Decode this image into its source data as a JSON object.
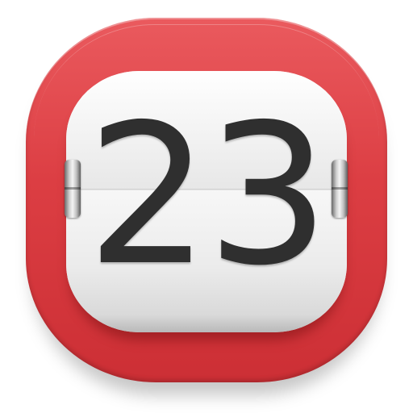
{
  "calendar_icon": {
    "day_number": "23",
    "colors": {
      "frame": "#dc3e43",
      "card": "#ececec",
      "digits": "#2f2f2f"
    }
  }
}
